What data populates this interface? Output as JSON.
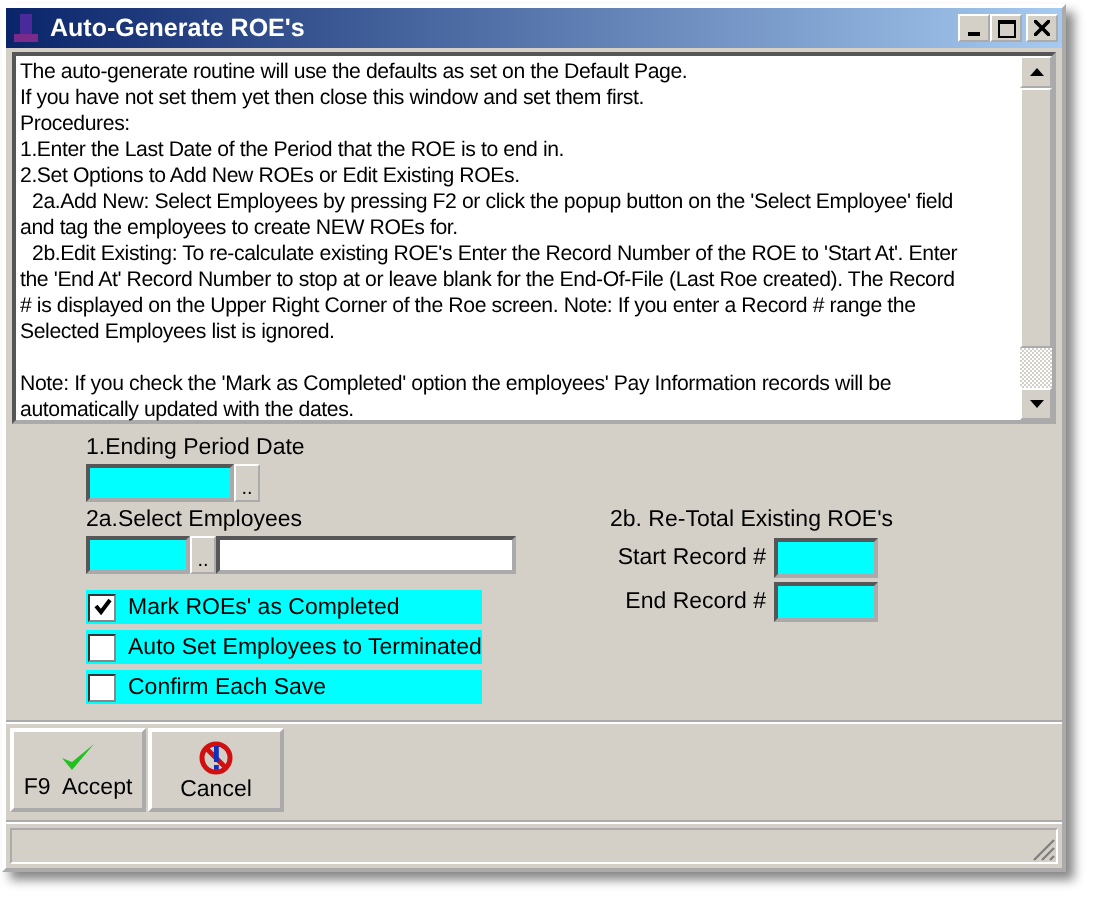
{
  "window": {
    "title": "Auto-Generate ROE's"
  },
  "memo": {
    "blocks": [
      {
        "lines": [
          {
            "text": "The auto-generate routine will use the defaults as set on the Default Page.",
            "indent": false
          },
          {
            "text": "If you have not set them yet then close this window and set them first.",
            "indent": false
          },
          {
            "text": "Procedures:",
            "indent": false
          },
          {
            "text": "1.Enter the Last Date of the Period that the ROE is to end in.",
            "indent": false
          },
          {
            "text": "2.Set Options to Add New ROEs or Edit Existing ROEs.",
            "indent": false
          },
          {
            "text": "2a.Add New: Select Employees by pressing F2 or click the popup button on the 'Select Employee' field",
            "indent": true
          },
          {
            "text": "and tag the employees to create NEW ROEs for.",
            "indent": false
          },
          {
            "text": "2b.Edit Existing: To re-calculate existing ROE's Enter the Record Number of the ROE to 'Start At'. Enter",
            "indent": true
          },
          {
            "text": "the 'End At' Record Number to stop at or leave blank for the End-Of-File (Last Roe created). The Record",
            "indent": false
          },
          {
            "text": "# is displayed on the Upper Right Corner of the Roe screen. Note: If you enter a Record # range the",
            "indent": false
          },
          {
            "text": "Selected Employees list is ignored.",
            "indent": false
          }
        ]
      },
      {
        "lines": [
          {
            "text": "Note: If you check the 'Mark as Completed' option the employees' Pay Information records will be",
            "indent": false
          },
          {
            "text": "automatically updated with the dates.",
            "indent": false
          }
        ]
      }
    ]
  },
  "ending_period_date": {
    "label": "1.Ending Period Date",
    "popup": ".."
  },
  "select_employees": {
    "label": "2a.Select Employees",
    "popup": ".."
  },
  "options": [
    {
      "label": "Mark ROEs' as Completed",
      "checked": true
    },
    {
      "label": "Auto Set Employees to Terminated",
      "checked": false
    },
    {
      "label": "Confirm Each Save",
      "checked": false
    }
  ],
  "retotal": {
    "title": "2b. Re-Total Existing ROE's",
    "start_label": "Start Record #",
    "end_label": "End Record #"
  },
  "buttons": [
    {
      "kind": "accept",
      "label": "F9  Accept"
    },
    {
      "kind": "cancel",
      "label": "Cancel"
    }
  ]
}
